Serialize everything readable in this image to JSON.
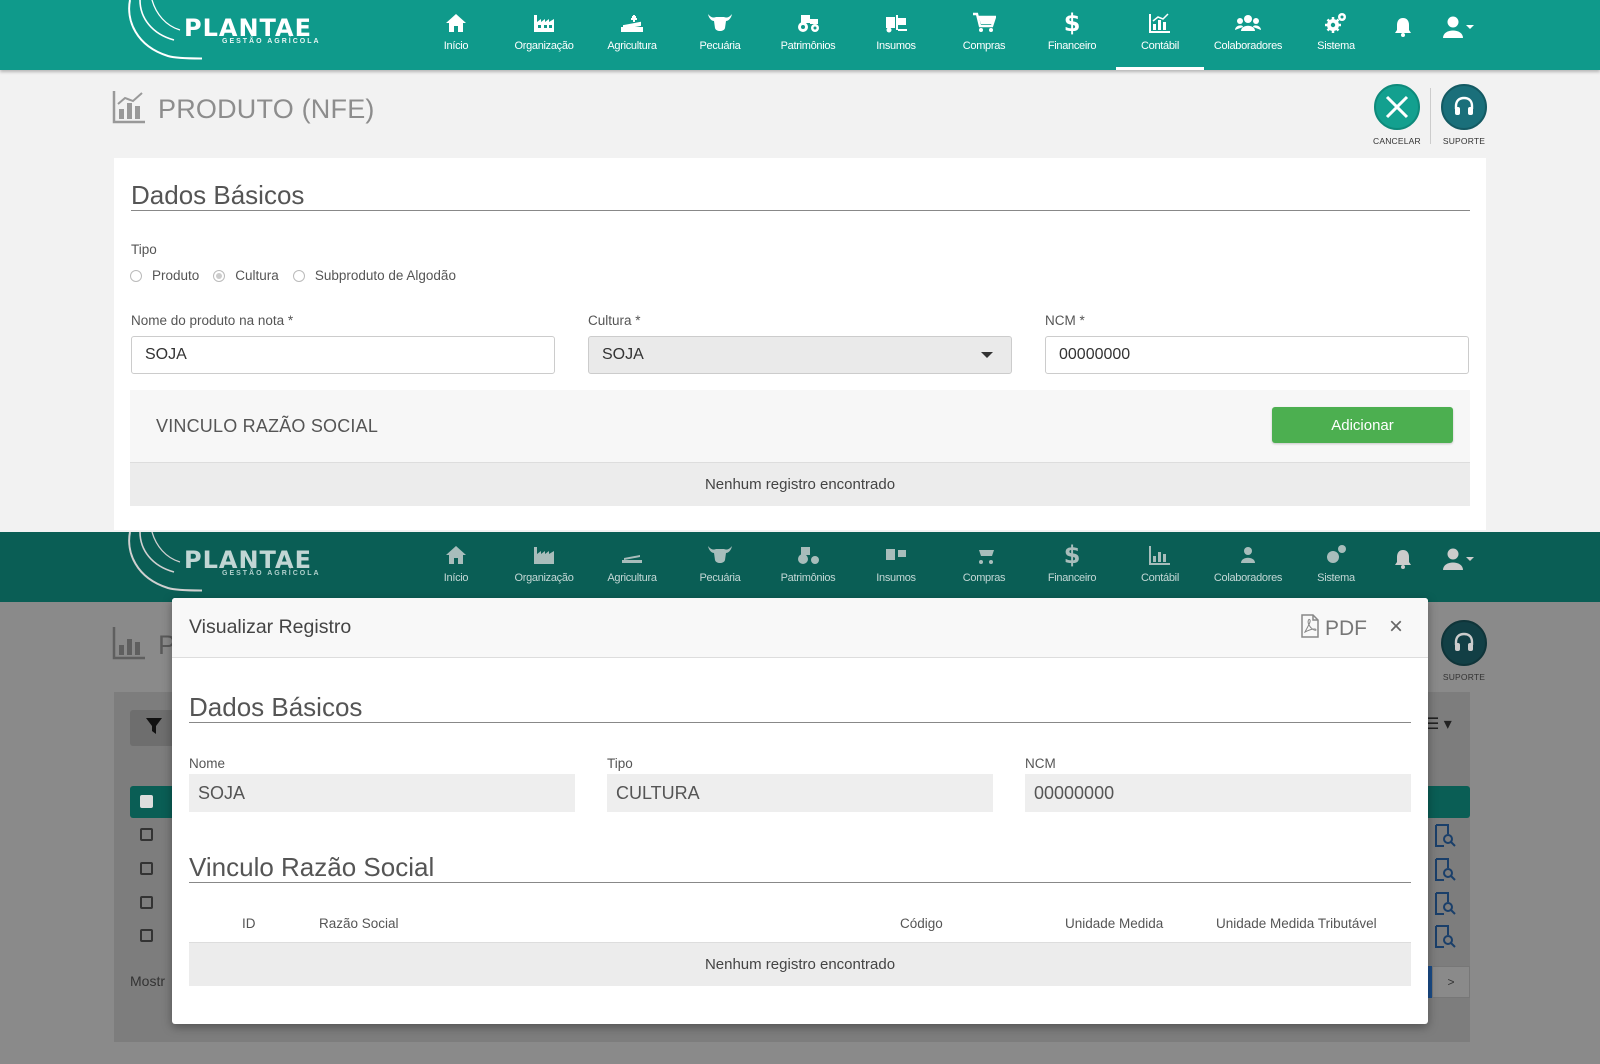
{
  "brand": {
    "name": "PLANTAE",
    "subtitle": "GESTÃO AGRÍCOLA"
  },
  "nav": [
    {
      "label": "Início",
      "icon": "home-icon"
    },
    {
      "label": "Organização",
      "icon": "factory-icon"
    },
    {
      "label": "Agricultura",
      "icon": "agriculture-icon"
    },
    {
      "label": "Pecuária",
      "icon": "cow-icon"
    },
    {
      "label": "Patrimônios",
      "icon": "tractor-icon"
    },
    {
      "label": "Insumos",
      "icon": "forklift-icon"
    },
    {
      "label": "Compras",
      "icon": "cart-icon"
    },
    {
      "label": "Financeiro",
      "icon": "dollar-icon"
    },
    {
      "label": "Contábil",
      "icon": "chart-icon",
      "active": true
    },
    {
      "label": "Colaboradores",
      "icon": "users-icon"
    },
    {
      "label": "Sistema",
      "icon": "gears-icon"
    }
  ],
  "page": {
    "title": "PRODUTO (NFE)",
    "cancel_label": "CANCELAR",
    "support_label": "SUPORTE",
    "section_title": "Dados Básicos",
    "tipo_label": "Tipo",
    "tipo_options": [
      "Produto",
      "Cultura",
      "Subproduto de Algodão"
    ],
    "tipo_selected": "Cultura",
    "nome_label": "Nome do produto na nota *",
    "nome_value": "SOJA",
    "cultura_label": "Cultura *",
    "cultura_value": "SOJA",
    "ncm_label": "NCM *",
    "ncm_value": "00000000",
    "vinculo_title": "VINCULO RAZÃO SOCIAL",
    "add_button": "Adicionar",
    "empty_message": "Nenhum registro encontrado"
  },
  "background": {
    "title_fragment": "P",
    "support_label": "SUPORTE",
    "footer_fragment": "Mostr",
    "pager_next": ">"
  },
  "modal": {
    "title": "Visualizar Registro",
    "pdf_label": "PDF",
    "close_label": "×",
    "section_title": "Dados Básicos",
    "nome_label": "Nome",
    "nome_value": "SOJA",
    "tipo_label": "Tipo",
    "tipo_value": "CULTURA",
    "ncm_label": "NCM",
    "ncm_value": "00000000",
    "vinculo_title": "Vinculo Razão Social",
    "columns": [
      "ID",
      "Razão Social",
      "Código",
      "Unidade Medida",
      "Unidade Medida Tributável"
    ],
    "empty_message": "Nenhum registro encontrado"
  },
  "colors": {
    "navbar": "#0f9a8b",
    "navbar_dim": "#0a5e55",
    "add_button": "#4caf50",
    "cancel_button": "#13a08f",
    "support_button": "#1a6f7a"
  }
}
